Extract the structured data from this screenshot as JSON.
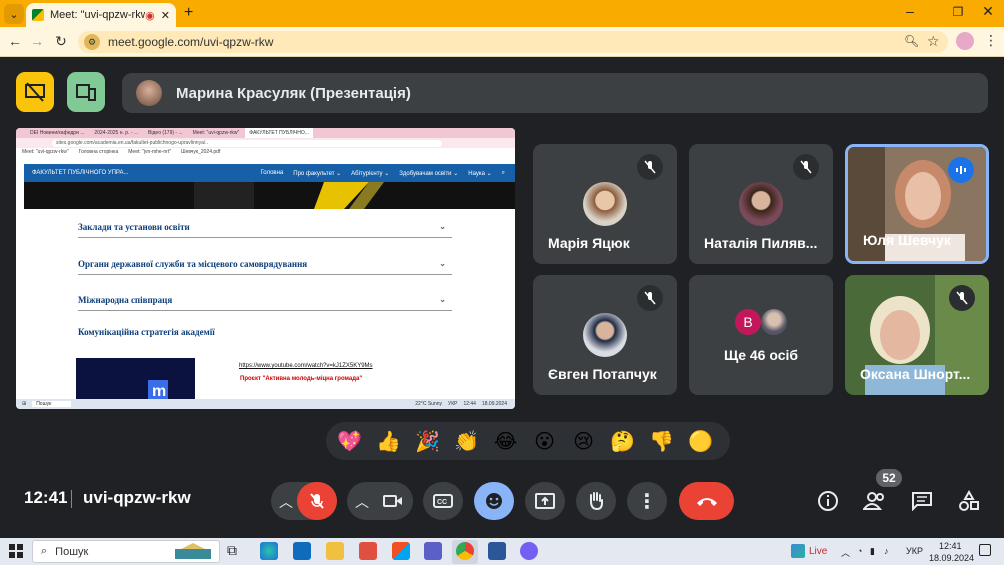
{
  "browser": {
    "tab_title": "Meet: \"uvi-qpzw-rkw\"",
    "url": "meet.google.com/uvi-qpzw-rkw"
  },
  "presentation": {
    "presenter_label": "Марина Красуляк (Презентація)"
  },
  "shared_screen": {
    "tabs": [
      "DEI Новини/кафедри ...",
      "2024-2025 н. р. - ...",
      "Відео (179) - ...",
      "Meet: \"uvi-qpzw-rkw\"",
      "ФАКУЛЬТЕТ ПУБЛІЧНО..."
    ],
    "url": "sites.google.com/academia.en.ua/fakultet-publichnogo-upravlinnya/..",
    "bookmarks": [
      "Meet: \"uvi-qpzw-rkw\"",
      "Головна сторінка",
      "Meet: \"jvn-mhe-nrt\"",
      "Шевчук_2024.pdf"
    ],
    "site_title": "ФАКУЛЬТЕТ ПУБЛІЧНОГО УПРА...",
    "nav_items": [
      "Головна",
      "Про факультет ⌄",
      "Абітурієнту ⌄",
      "Здобувачам освіти ⌄",
      "Наука ⌄"
    ],
    "sections": [
      "Заклади та установи освіти",
      "Органи державної служби та місцевого самоврядування",
      "Міжнародна співпраця"
    ],
    "comm_heading": "Комунікаційна стратегія академії",
    "video_link": "https://www.youtube.com/watch?v=kJ1ZX5KY9Ms",
    "project_text": "Проєкт  \"Активна молодь-міцна громада\"",
    "taskbar_search": "Пошук",
    "taskbar_weather": "22°C  Sunny",
    "taskbar_lang": "УКР",
    "taskbar_time": "12:44",
    "taskbar_date": "18.09.2024"
  },
  "participants": [
    {
      "name": "Марія Яцюк",
      "muted": true
    },
    {
      "name": "Наталія Пиляв...",
      "muted": true
    },
    {
      "name": "Юля Шевчук",
      "muted": false,
      "speaking": true
    },
    {
      "name": "Євген Потапчук",
      "muted": true
    },
    {
      "name": "Ще 46 осіб",
      "avatar_letter": "В"
    },
    {
      "name": "Оксана Шнорт...",
      "muted": true
    }
  ],
  "reactions": [
    "💖",
    "👍",
    "🎉",
    "👏",
    "😂",
    "😮",
    "😢",
    "🤔",
    "👎",
    "🟡"
  ],
  "meeting": {
    "time": "12:41",
    "code": "uvi-qpzw-rkw",
    "participant_count": "52"
  },
  "taskbar": {
    "search_placeholder": "Пошук",
    "live": "Live",
    "lang": "УКР",
    "time": "12:41",
    "date": "18.09.2024"
  },
  "colors": {
    "chrome_orange": "#f9ab00",
    "meet_bg": "#202124",
    "end_call": "#ea4335",
    "reaction_active": "#8ab4f8"
  }
}
